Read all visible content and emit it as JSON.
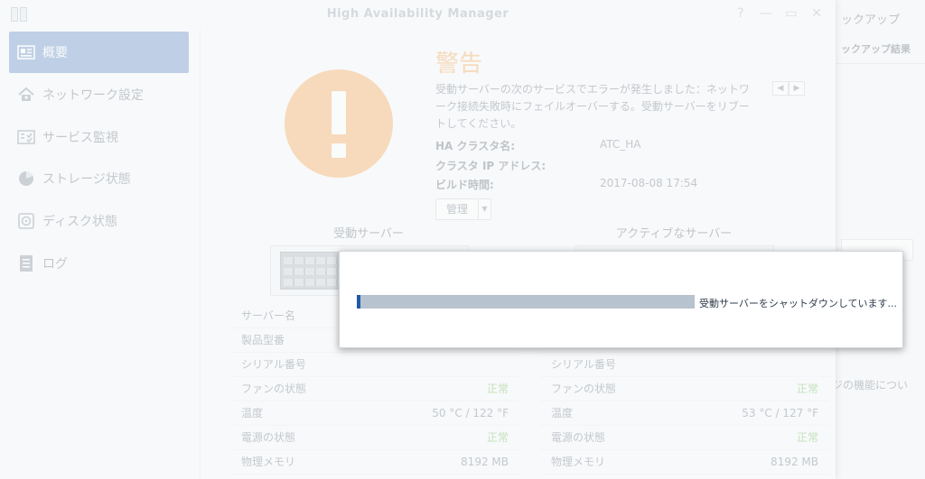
{
  "background_window": {
    "title": "ックアップ",
    "subtitle": "ックアップ結果",
    "text": "ジの機能につい"
  },
  "window": {
    "title": "High Availability Manager",
    "controls": [
      "?",
      "—",
      "▭",
      "✕"
    ]
  },
  "sidebar": {
    "items": [
      {
        "label": "概要",
        "icon": "overview-icon",
        "active": true
      },
      {
        "label": "ネットワーク設定",
        "icon": "network-icon",
        "active": false
      },
      {
        "label": "サービス監視",
        "icon": "service-monitor-icon",
        "active": false
      },
      {
        "label": "ストレージ状態",
        "icon": "storage-pie-icon",
        "active": false
      },
      {
        "label": "ディスク状態",
        "icon": "disk-icon",
        "active": false
      },
      {
        "label": "ログ",
        "icon": "log-icon",
        "active": false
      }
    ]
  },
  "warning": {
    "title": "警告",
    "description": "受動サーバーの次のサービスでエラーが発生しました：ネットワーク接続失敗時にフェイルオーバーする。受動サーバーをリブートしてください。",
    "color": "#f08a1c",
    "pager": [
      "◀",
      "▶"
    ]
  },
  "info": {
    "cluster_name_label": "HA クラスタ名:",
    "cluster_name_value": "ATC_HA",
    "cluster_ip_label": "クラスタ IP アドレス:",
    "cluster_ip_value": "",
    "build_time_label": "ビルド時間:",
    "build_time_value": "2017-08-08 17:54"
  },
  "manage_button": {
    "label": "管理"
  },
  "passive_server": {
    "heading": "受動サーバー",
    "rows": [
      {
        "key": "サーバー名",
        "value": ""
      },
      {
        "key": "製品型番",
        "value": ""
      },
      {
        "key": "シリアル番号",
        "value": ""
      },
      {
        "key": "ファンの状態",
        "value": "正常"
      },
      {
        "key": "温度",
        "value": "50 °C / 122 °F"
      },
      {
        "key": "電源の状態",
        "value": "正常"
      },
      {
        "key": "物理メモリ",
        "value": "8192 MB"
      }
    ]
  },
  "active_server": {
    "heading": "アクティブなサーバー",
    "rows": [
      {
        "key": "",
        "value": ""
      },
      {
        "key": "",
        "value": ""
      },
      {
        "key": "シリアル番号",
        "value": ""
      },
      {
        "key": "ファンの状態",
        "value": "正常"
      },
      {
        "key": "温度",
        "value": "53 °C / 127 °F"
      },
      {
        "key": "電源の状態",
        "value": "正常"
      },
      {
        "key": "物理メモリ",
        "value": "8192 MB"
      }
    ]
  },
  "progress_dialog": {
    "message": "受動サーバーをシャットダウンしています...",
    "progress_fraction": 0.01,
    "accent": "#1f5aa8"
  },
  "colors": {
    "ok": "#3aa01a",
    "sidebar_active": "#2c65b2"
  }
}
